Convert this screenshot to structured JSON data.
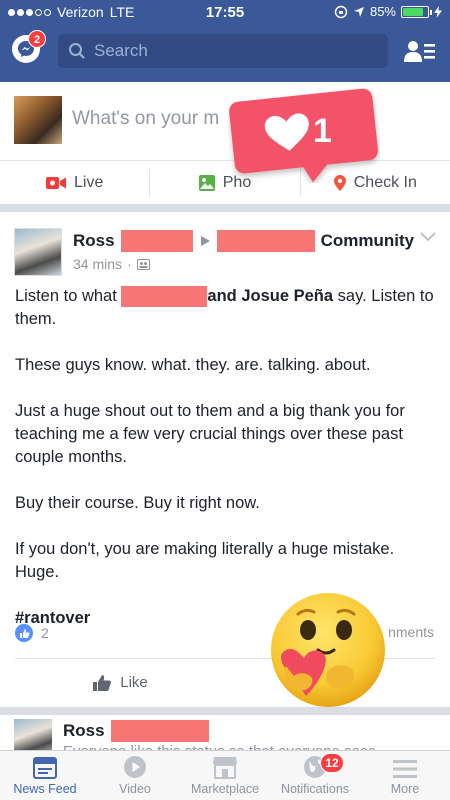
{
  "status_bar": {
    "carrier": "Verizon",
    "network": "LTE",
    "time": "17:55",
    "battery": "85%",
    "battery_level": 0.85
  },
  "header": {
    "messenger_badge": "2",
    "search_placeholder": "Search"
  },
  "composer": {
    "prompt": "What's on your m",
    "actions": [
      {
        "label": "Live",
        "icon": "live-video-icon"
      },
      {
        "label": "Pho",
        "icon": "photo-icon"
      },
      {
        "label": "Check In",
        "icon": "location-pin-icon"
      }
    ]
  },
  "like_notification": {
    "count": "1",
    "icon": "heart-icon",
    "color": "#f25268"
  },
  "post": {
    "author": "Ross",
    "group_suffix": "Community",
    "time": "34 mins",
    "audience_icon": "group-audience-icon",
    "line1_start": "Listen to what",
    "line1_bold": "and Josue Peña",
    "line1_end": "say. Listen to them.",
    "p2": "These guys know. what. they. are. talking. about.",
    "p3": "Just a huge shout out to them and a big thank you for teaching me a few very crucial things over these past couple months.",
    "p4": "Buy their course. Buy it right now.",
    "p5": "If you don't, you are making literally a huge mistake. Huge.",
    "hashtag": "#rantover",
    "likes_count": "2",
    "comments_label": "nments",
    "like_action": "Like"
  },
  "next_post": {
    "author": "Ross",
    "preview": "Everyone like this status so that everyone sees"
  },
  "tabs": [
    {
      "label": "News Feed",
      "icon": "news-feed-icon",
      "active": true
    },
    {
      "label": "Video",
      "icon": "video-play-icon"
    },
    {
      "label": "Marketplace",
      "icon": "marketplace-icon"
    },
    {
      "label": "Notifications",
      "icon": "globe-icon",
      "badge": "12"
    },
    {
      "label": "More",
      "icon": "menu-icon"
    }
  ],
  "colors": {
    "fb_blue": "#3b5998",
    "redaction": "#f87575",
    "badge_red": "#fa3e3e",
    "active_tab": "#4267b2"
  }
}
